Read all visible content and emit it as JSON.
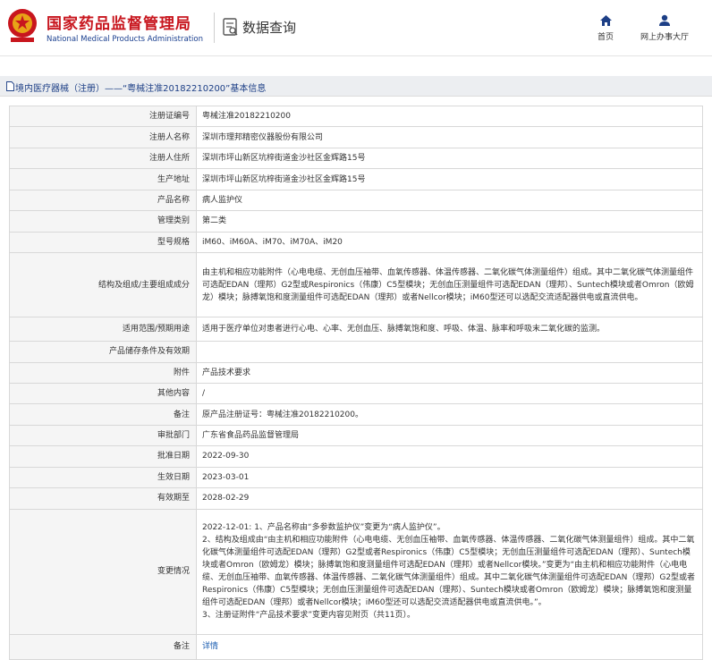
{
  "header": {
    "title": "国家药品监督管理局",
    "subtitle": "National Medical Products Administration",
    "section": "数据查询",
    "nav": [
      {
        "label": "首页",
        "icon": "home-icon"
      },
      {
        "label": "网上办事大厅",
        "icon": "user-icon"
      }
    ],
    "colors": {
      "brand_red": "#c8161e",
      "brand_blue": "#1a3f8f",
      "link_blue": "#1a5cb0"
    }
  },
  "titlebar": {
    "text": "境内医疗器械（注册）——“粤械注准20182210200”基本信息"
  },
  "rows": [
    {
      "label": "注册证编号",
      "value": "粤械注准20182210200"
    },
    {
      "label": "注册人名称",
      "value": "深圳市理邦精密仪器股份有限公司"
    },
    {
      "label": "注册人住所",
      "value": "深圳市坪山新区坑梓街道金沙社区金辉路15号"
    },
    {
      "label": "生产地址",
      "value": "深圳市坪山新区坑梓街道金沙社区金辉路15号"
    },
    {
      "label": "产品名称",
      "value": "病人监护仪"
    },
    {
      "label": "管理类别",
      "value": "第二类"
    },
    {
      "label": "型号规格",
      "value": "iM60、iM60A、iM70、iM70A、iM20"
    },
    {
      "label": "结构及组成/主要组成成分",
      "value": "由主机和相应功能附件（心电电缆、无创血压袖带、血氧传感器、体温传感器、二氧化碳气体测量组件）组成。其中二氧化碳气体测量组件可选配EDAN（理邦）G2型或Respironics（伟康）C5型模块；无创血压测量组件可选配EDAN（理邦）、Suntech模块或者Omron（欧姆龙）模块；脉搏氧饱和度测量组件可选配EDAN（理邦）或者Nellcor模块；iM60型还可以选配交流适配器供电或直流供电。"
    },
    {
      "label": "适用范围/预期用途",
      "value": "适用于医疗单位对患者进行心电、心率、无创血压、脉搏氧饱和度、呼吸、体温、脉率和呼吸末二氧化碳的监测。"
    },
    {
      "label": "产品储存条件及有效期",
      "value": ""
    },
    {
      "label": "附件",
      "value": "产品技术要求"
    },
    {
      "label": "其他内容",
      "value": "/"
    },
    {
      "label": "备注",
      "value": "原产品注册证号：粤械注准20182210200。"
    },
    {
      "label": "审批部门",
      "value": "广东省食品药品监督管理局"
    },
    {
      "label": "批准日期",
      "value": "2022-09-30"
    },
    {
      "label": "生效日期",
      "value": "2023-03-01"
    },
    {
      "label": "有效期至",
      "value": "2028-02-29"
    }
  ],
  "changes": {
    "label": "变更情况",
    "lines": [
      "2022-12-01: 1、产品名称由“多参数监护仪”变更为“病人监护仪”。",
      "2、结构及组成由“由主机和相应功能附件（心电电缆、无创血压袖带、血氧传感器、体温传感器、二氧化碳气体测量组件）组成。其中二氧化碳气体测量组件可选配EDAN（理邦）G2型或者Respironics（伟康）C5型模块；无创血压测量组件可选配EDAN（理邦）、Suntech模块或者Omron（欧姆龙）模块；脉搏氧饱和度测量组件可选配EDAN（理邦）或者Nellcor模块。”变更为“由主机和相应功能附件（心电电缆、无创血压袖带、血氧传感器、体温传感器、二氧化碳气体测量组件）组成。其中二氧化碳气体测量组件可选配EDAN（理邦）G2型或者Respironics（伟康）C5型模块；无创血压测量组件可选配EDAN（理邦）、Suntech模块或者Omron（欧姆龙）模块；脉搏氧饱和度测量组件可选配EDAN（理邦）或者Nellcor模块；iM60型还可以选配交流适配器供电或直流供电。”。",
      "3、注册证附件“产品技术要求”变更内容见附页（共11页）。"
    ]
  },
  "footer_row": {
    "label": "备注",
    "link": "详情"
  }
}
